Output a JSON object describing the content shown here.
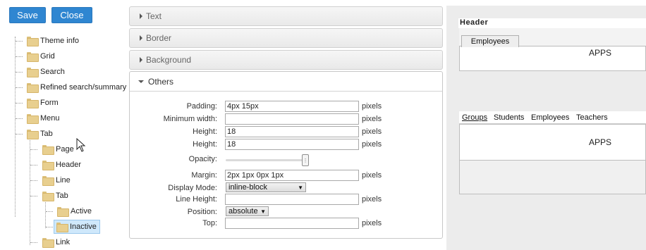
{
  "toolbar": {
    "save_label": "Save",
    "close_label": "Close"
  },
  "tree": {
    "items": [
      {
        "label": "Theme info"
      },
      {
        "label": "Grid"
      },
      {
        "label": "Search"
      },
      {
        "label": "Refined search/summary"
      },
      {
        "label": "Form"
      },
      {
        "label": "Menu"
      },
      {
        "label": "Tab"
      },
      {
        "label": "Page"
      },
      {
        "label": "Header"
      },
      {
        "label": "Line"
      },
      {
        "label": "Tab"
      },
      {
        "label": "Active"
      },
      {
        "label": "Inactive"
      },
      {
        "label": "Link"
      }
    ],
    "selected": "Inactive"
  },
  "sections": {
    "text": "Text",
    "border": "Border",
    "background": "Background",
    "others": "Others"
  },
  "form": {
    "padding_label": "Padding:",
    "padding_value": "4px 15px",
    "padding_unit": "pixels",
    "minwidth_label": "Minimum width:",
    "minwidth_value": "",
    "minwidth_unit": "pixels",
    "height1_label": "Height:",
    "height1_value": "18",
    "height1_unit": "pixels",
    "height2_label": "Height:",
    "height2_value": "18",
    "height2_unit": "pixels",
    "opacity_label": "Opacity:",
    "opacity_value": 1.0,
    "margin_label": "Margin:",
    "margin_value": "2px 1px 0px 1px",
    "margin_unit": "pixels",
    "display_label": "Display Mode:",
    "display_value": "inline-block",
    "lineheight_label": "Line Height:",
    "lineheight_value": "",
    "lineheight_unit": "pixels",
    "position_label": "Position:",
    "position_value": "absolute",
    "top_label": "Top:",
    "top_value": "",
    "top_unit": "pixels"
  },
  "preview": {
    "header_label": "Header",
    "tab_label": "Employees",
    "apps_top": "APPS",
    "links": [
      "Groups",
      "Students",
      "Employees",
      "Teachers"
    ],
    "apps_bottom": "APPS"
  }
}
